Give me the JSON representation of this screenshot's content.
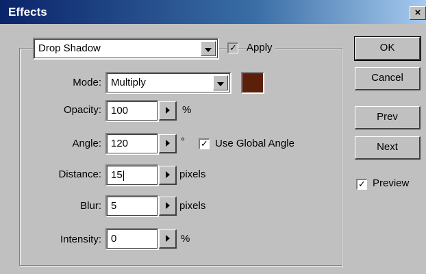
{
  "window": {
    "title": "Effects",
    "close_glyph": "×"
  },
  "effect": {
    "selected": "Drop Shadow",
    "apply_label": "Apply",
    "apply_checked": true
  },
  "mode": {
    "label": "Mode:",
    "value": "Multiply"
  },
  "shadow_color": "#5a200a",
  "fields": {
    "opacity": {
      "label": "Opacity:",
      "value": "100",
      "unit": "%"
    },
    "angle": {
      "label": "Angle:",
      "value": "120",
      "unit": "°"
    },
    "distance": {
      "label": "Distance:",
      "value": "15",
      "unit": "pixels"
    },
    "blur": {
      "label": "Blur:",
      "value": "5",
      "unit": "pixels"
    },
    "intensity": {
      "label": "Intensity:",
      "value": "0",
      "unit": "%"
    }
  },
  "global_angle": {
    "label": "Use Global Angle",
    "checked": true
  },
  "buttons": {
    "ok": "OK",
    "cancel": "Cancel",
    "prev": "Prev",
    "next": "Next"
  },
  "preview": {
    "label": "Preview",
    "checked": true
  }
}
